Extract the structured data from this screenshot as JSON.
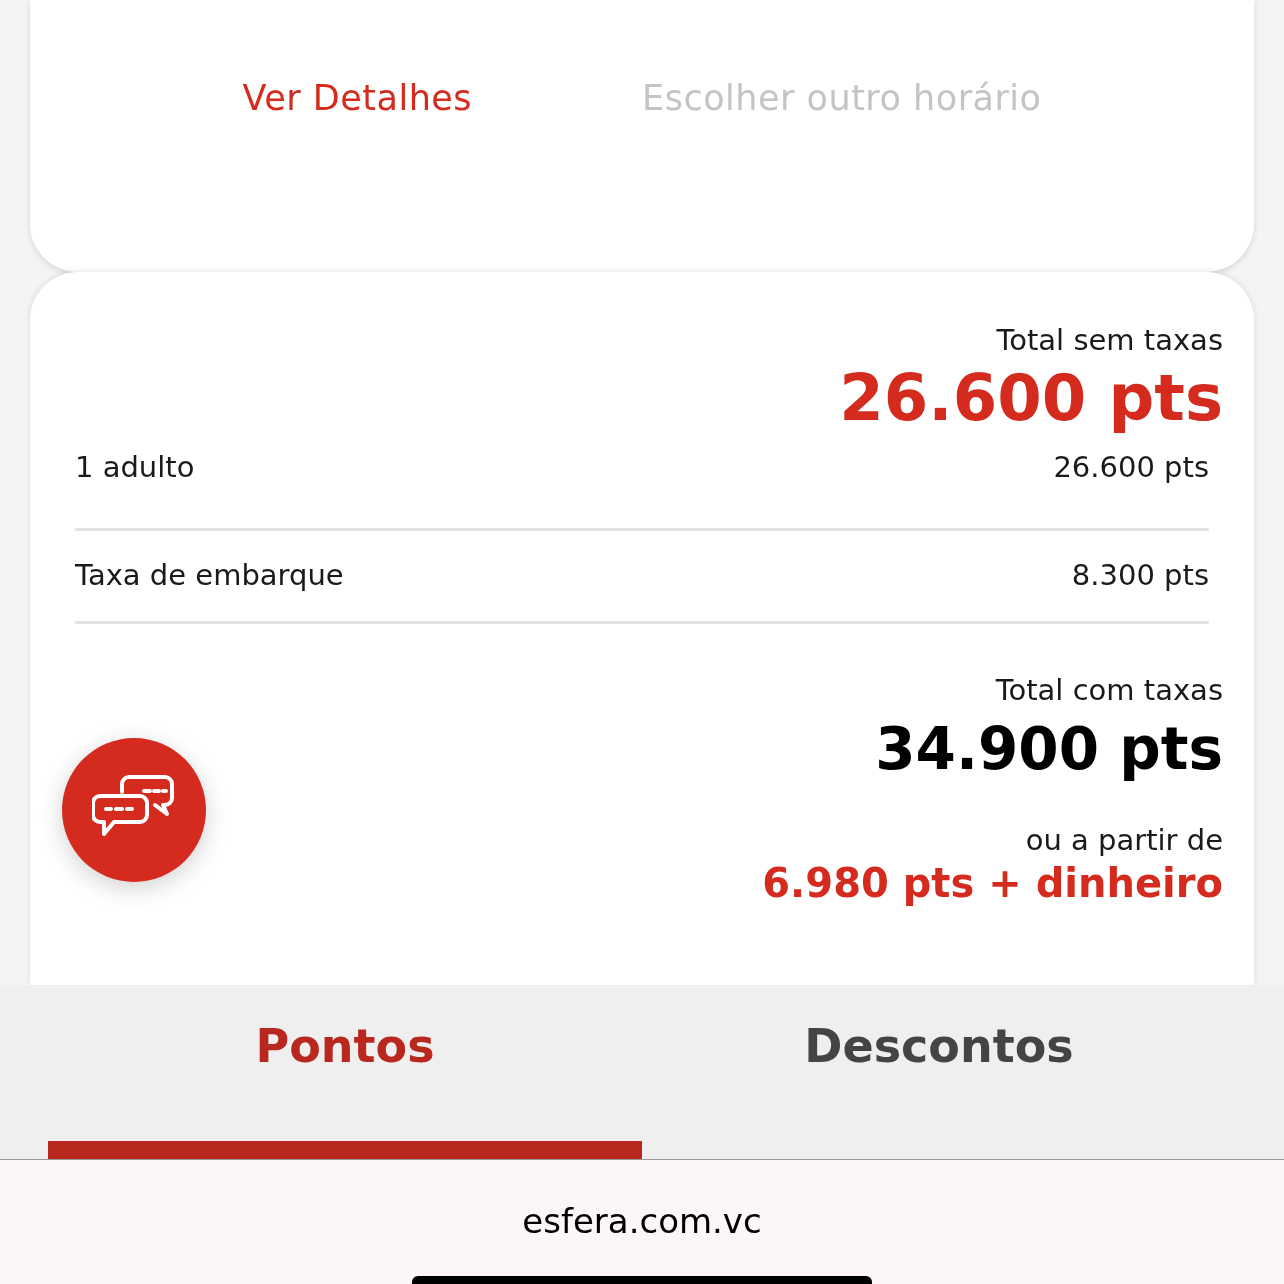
{
  "flight_actions": [
    {
      "label": "Ver Detalhes",
      "disabled": false
    },
    {
      "label": "Escolher outro horário",
      "disabled": true
    }
  ],
  "summary": {
    "subtotal_label": "Total sem taxas",
    "subtotal": "26.600 pts",
    "lines": [
      {
        "label": "1 adulto",
        "value": "26.600 pts"
      },
      {
        "label": "Taxa de embarque",
        "value": "8.300 pts"
      }
    ],
    "total_label": "Total com taxas",
    "total": "34.900 pts",
    "alt_label": "ou a partir de",
    "alt_value": "6.980 pts + dinheiro"
  },
  "tabs": [
    {
      "label": "Pontos",
      "selected": true
    },
    {
      "label": "Descontos",
      "selected": false
    }
  ],
  "address_bar": {
    "url": "esfera.com.vc"
  }
}
